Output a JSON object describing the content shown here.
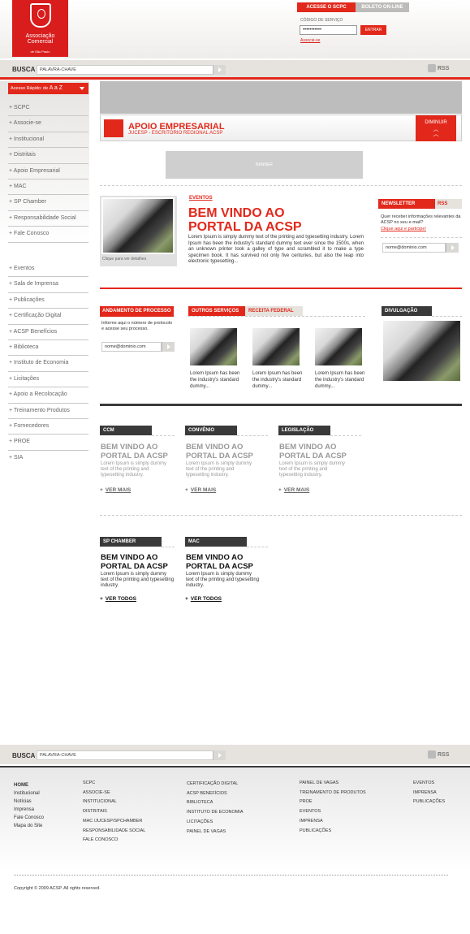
{
  "logo": {
    "line1": "Associação",
    "line2": "Comercial",
    "line3": "de São Paulo"
  },
  "top_tabs": {
    "scpc": "ACESSE O SCPC",
    "boleto": "BOLETO ON-LINE"
  },
  "login": {
    "code_label": "CÓDIGO DE SERVIÇO",
    "password_value": "•••••••••••",
    "enter_button": "ENTRAR",
    "signup_link": "Associe-se"
  },
  "search": {
    "label": "BUSCA",
    "placeholder": "PALAVRA-CHAVE",
    "rss": "RSS"
  },
  "quick_access": {
    "prefix": "Acesso Rápido: de",
    "range": "A a Z"
  },
  "nav_primary": [
    "SCPC",
    "Associe-se",
    "Institucional",
    "Distritais",
    "Apoio Empresarial",
    "MAC",
    "SP Chamber",
    "Responsabilidade Social",
    "Fale Conosco"
  ],
  "nav_secondary": [
    "Eventos",
    "Sala de Imprensa",
    "Publicações",
    "Certificação Digital",
    "ACSP Benefícios",
    "Biblioteca",
    "Instituto de Economia",
    "Licitações",
    "Apoio a Recolocação",
    "Treinamento Produtos",
    "Fornecedores",
    "PROE",
    "SIA"
  ],
  "apoio": {
    "title": "APOIO EMPRESARIAL",
    "subtitle": "JUCESP - ESCRITÓRIO REGIONAL ACSP",
    "toggle": "DIMINUIR"
  },
  "banner": {
    "label": "BANNER"
  },
  "welcome": {
    "caption": "Clique para ver detalhes",
    "category": "EVENTOS",
    "title_line1": "BEM VINDO AO",
    "title_line2": "PORTAL DA ACSP",
    "body": "Lorem Ipsum is simply dummy text of the printing and typesetting industry. Lorem Ipsum has been the industry's standard dummy text ever since the 1500s, when an unknown printer took a galley of type and scrambled it to make a type specimen book. It has survived not only five centuries, but also the leap into electronic typesetting..."
  },
  "newsletter": {
    "tab": "NEWSLETTER",
    "rss_tab": "RSS",
    "text": "Quer receber informações relevantes da ACSP no seu e-mail?",
    "link": "Clique aqui e participe!",
    "email_value": "nome@dominio.com"
  },
  "andamento": {
    "tab": "ANDAMENTO DE PROCESSO",
    "text": "Informe aqui o número de protocolo e acesse seu processo.",
    "input_value": "nome@dominio.com"
  },
  "services": {
    "tab_active": "OUTROS SERVIÇOS",
    "tab_inactive": "RECEITA FEDERAL",
    "items": [
      "Lorem Ipsum has been the industry's standard dummy...",
      "Lorem Ipsum has been the industry's standard dummy...",
      "Lorem Ipsum has been the industry's standard dummy..."
    ]
  },
  "divulgacao": {
    "tab": "DIVULGAÇÃO"
  },
  "boxes": [
    {
      "tab": "CCM",
      "title_line1": "BEM VINDO AO",
      "title_line2": "PORTAL DA ACSP",
      "text": "Lorem Ipsum is simply dummy text of the printing and typesetting industry.",
      "link": "VER MAIS"
    },
    {
      "tab": "CONVÊNIO",
      "title_line1": "BEM VINDO AO",
      "title_line2": "PORTAL DA ACSP",
      "text": "Lorem Ipsum is simply dummy text of the printing and typesetting industry.",
      "link": "VER MAIS"
    },
    {
      "tab": "LEGISLAÇÃO",
      "title_line1": "BEM VINDO AO",
      "title_line2": "PORTAL DA ACSP",
      "text": "Lorem Ipsum is simply dummy text of the printing and typesetting industry.",
      "link": "VER MAIS"
    },
    {
      "tab": "SP CHAMBER",
      "title_line1": "BEM VINDO AO",
      "title_line2": "PORTAL DA ACSP",
      "text": "Lorem Ipsum is simply dummy text of the printing and typesetting industry.",
      "link": "VER TODOS"
    },
    {
      "tab": "MAC",
      "title_line1": "BEM VINDO AO",
      "title_line2": "PORTAL DA ACSP",
      "text": "Lorem Ipsum is simply dummy text of the printing and typesetting industry.",
      "link": "VER TODOS"
    }
  ],
  "footer": {
    "col1": [
      "HOME",
      "Institucional",
      "Notícias",
      "Imprensa",
      "Fale Conosco",
      "Mapa do Site"
    ],
    "col2": [
      "SCPC",
      "ASSOCIE-SE",
      "INSTITUCIONAL",
      "DISTRITAIS",
      "MAC /JUCESP/SPCHAMBER",
      "RESPONSABILIDADE SOCIAL",
      "FALE CONOSCO"
    ],
    "col3": [
      "CERTIFICAÇÃO DIGITAL",
      "ACSP BENEFÍCIOS",
      "BIBLIOTECA",
      "INSTITUTO DE ECONOMIA",
      "LICITAÇÕES",
      "PAINEL DE VAGAS"
    ],
    "col4": [
      "PAINEL DE VAGAS",
      "TREINAMENTO DE PRODUTOS",
      "PROE",
      "EVENTOS",
      "IMPRENSA",
      "PUBLICAÇÕES"
    ],
    "col5": [
      "EVENTOS",
      "IMPRENSA",
      "PUBLICAÇÕES"
    ],
    "copyright": "Copyright © 2009 ACSP. All rights reserved."
  },
  "colors": {
    "accent": "#e2281b",
    "dark": "#3a3a3a",
    "bar": "#e6e3de"
  }
}
